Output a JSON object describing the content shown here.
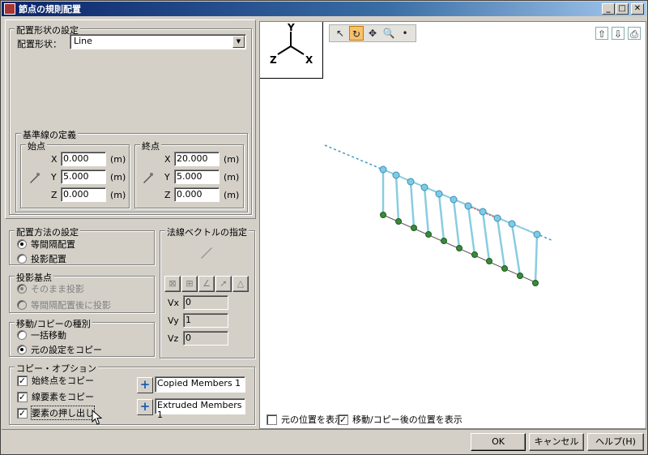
{
  "window": {
    "title": "節点の規則配置"
  },
  "layout_group": {
    "title": "配置形状の設定",
    "shape_label": "配置形状：",
    "shape_value": "Line"
  },
  "baseline_group": {
    "title": "基準線の定義",
    "start": {
      "title": "始点",
      "x_label": "X",
      "y_label": "Y",
      "z_label": "Z",
      "x": "0.000",
      "y": "5.000",
      "z": "0.000",
      "unit": "(m)"
    },
    "end": {
      "title": "終点",
      "x_label": "X",
      "y_label": "Y",
      "z_label": "Z",
      "x": "20.000",
      "y": "5.000",
      "z": "0.000",
      "unit": "(m)"
    }
  },
  "method_group": {
    "title": "配置方法の設定",
    "opt1": "等間隔配置",
    "opt2": "投影配置"
  },
  "projection_group": {
    "title": "投影基点",
    "opt1": "そのまま投影",
    "opt2": "等間隔配置後に投影"
  },
  "move_group": {
    "title": "移動/コピーの種別",
    "opt1": "一括移動",
    "opt2": "元の設定をコピー"
  },
  "normal_group": {
    "title": "法線ベクトルの指定",
    "vx_label": "Vx",
    "vy_label": "Vy",
    "vz_label": "Vz",
    "vx": "0",
    "vy": "1",
    "vz": "0"
  },
  "copy_group": {
    "title": "コピー・オプション",
    "cb1": "始終点をコピー",
    "cb2": "線要素をコピー",
    "cb3": "要素の押し出し",
    "name1": "Copied Members  1",
    "name2": "Extruded Members  1"
  },
  "viewport": {
    "axis_x": "X",
    "axis_y": "Y",
    "axis_z": "Z",
    "show_original": "元の位置を表示",
    "show_after": "移動/コピー後の位置を表示"
  },
  "buttons": {
    "ok": "OK",
    "cancel": "キャンセル",
    "help": "ヘルプ(H)"
  }
}
